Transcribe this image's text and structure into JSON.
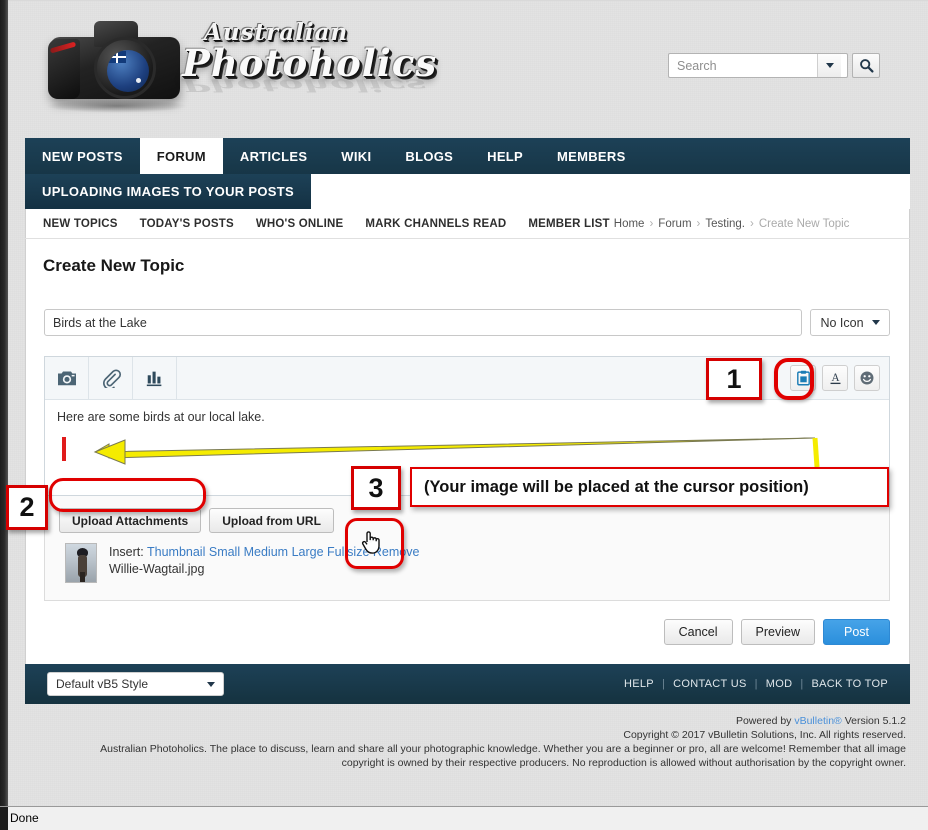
{
  "site": {
    "logo_line1": "Australian",
    "logo_line2": "Photoholics"
  },
  "search": {
    "placeholder": "Search",
    "value": "",
    "icon": "magnifier-icon",
    "dropdown_icon": "chevron-down-icon"
  },
  "nav": {
    "tabs": [
      {
        "label": "NEW POSTS",
        "active": false
      },
      {
        "label": "FORUM",
        "active": true
      },
      {
        "label": "ARTICLES",
        "active": false
      },
      {
        "label": "WIKI",
        "active": false
      },
      {
        "label": "BLOGS",
        "active": false
      },
      {
        "label": "HELP",
        "active": false
      },
      {
        "label": "MEMBERS",
        "active": false
      }
    ],
    "subnav_active": "UPLOADING IMAGES TO YOUR POSTS",
    "links": [
      "NEW TOPICS",
      "TODAY'S POSTS",
      "WHO'S ONLINE",
      "MARK CHANNELS READ",
      "MEMBER LIST"
    ],
    "breadcrumb": [
      "Home",
      "Forum",
      "Testing.",
      "Create New Topic"
    ],
    "breadcrumb_separator": "›"
  },
  "page": {
    "title": "Create New Topic"
  },
  "form": {
    "title_value": "Birds at the Lake",
    "title_placeholder": "",
    "icon_select_value": "No Icon",
    "editor": {
      "toolbar_left_icons": [
        "camera-icon",
        "paperclip-icon",
        "poll-chart-icon"
      ],
      "toolbar_right_icons": [
        "clipboard-paste-icon",
        "font-underline-a-icon",
        "smiley-icon"
      ],
      "body_text": "Here are some birds at our local lake."
    },
    "attachments": {
      "upload_button": "Upload Attachments",
      "upload_url_button": "Upload from URL",
      "insert_label": "Insert:",
      "size_links": [
        "Thumbnail",
        "Small",
        "Medium",
        "Large",
        "Fullsize"
      ],
      "remove_link": "Remove",
      "filename": "Willie-Wagtail.jpg"
    },
    "actions": {
      "cancel": "Cancel",
      "preview": "Preview",
      "post": "Post"
    }
  },
  "footer": {
    "style_select": "Default vB5 Style",
    "links": [
      "HELP",
      "CONTACT US",
      "MOD",
      "BACK TO TOP"
    ],
    "link_separator": "|",
    "powered_prefix": "Powered by ",
    "powered_link": "vBulletin®",
    "powered_suffix": " Version 5.1.2",
    "copyright": "Copyright © 2017 vBulletin Solutions, Inc. All rights reserved.",
    "blurb": "Australian Photoholics. The place to discuss, learn and share all your photographic knowledge. Whether you are a beginner or pro, all are welcome! Remember that all image copyright is owned by their respective producers. No reproduction is allowed without authorisation by the copyright owner."
  },
  "annotations": {
    "one": "1",
    "two": "2",
    "three": "3",
    "callout": "(Your image will be placed at the cursor position)"
  },
  "status_bar": {
    "text": "Done"
  },
  "colors": {
    "nav_bar": "#1d4157",
    "post_button": "#2b8fdc",
    "link_blue": "#3a7cc4",
    "annotation_red": "#e00000",
    "arrow_yellow": "#f5ec00",
    "caret_red": "#e01b1b"
  }
}
